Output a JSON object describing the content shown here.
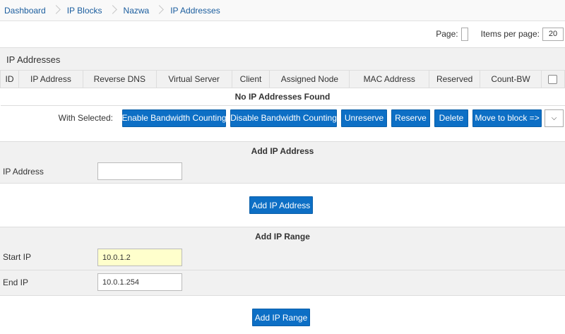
{
  "breadcrumb": [
    "Dashboard",
    "IP Blocks",
    "Nazwa",
    "IP Addresses"
  ],
  "pagination": {
    "page_label": "Page:",
    "items_per_page_label": "Items per page:",
    "items_per_page_value": "20"
  },
  "panel": {
    "title": "IP Addresses"
  },
  "table": {
    "columns": [
      "ID",
      "IP Address",
      "Reverse DNS",
      "Virtual Server",
      "Client",
      "Assigned Node",
      "MAC Address",
      "Reserved",
      "Count-BW"
    ],
    "empty_message": "No IP Addresses Found"
  },
  "actions": {
    "with_selected_label": "With Selected:",
    "buttons": [
      "Enable Bandwidth Counting",
      "Disable Bandwidth Counting",
      "Unreserve",
      "Reserve",
      "Delete",
      "Move to block =>"
    ]
  },
  "add_ip": {
    "header": "Add IP Address",
    "field_label": "IP Address",
    "field_value": "",
    "button": "Add IP Address"
  },
  "add_range": {
    "header": "Add IP Range",
    "start_label": "Start IP",
    "start_value": "10.0.1.2",
    "end_label": "End IP",
    "end_value": "10.0.1.254",
    "button": "Add IP Range"
  }
}
